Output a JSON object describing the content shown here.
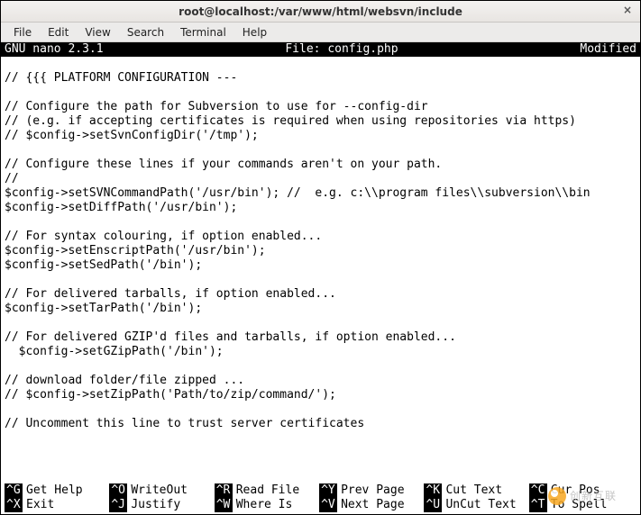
{
  "window": {
    "title": "root@localhost:/var/www/html/websvn/include",
    "close_glyph": "×"
  },
  "menubar": {
    "file": "File",
    "edit": "Edit",
    "view": "View",
    "search": "Search",
    "terminal": "Terminal",
    "help": "Help"
  },
  "nano": {
    "version": "GNU nano 2.3.1",
    "file_label": "File: config.php",
    "status": "Modified"
  },
  "content": "\n// {{{ PLATFORM CONFIGURATION ---\n\n// Configure the path for Subversion to use for --config-dir\n// (e.g. if accepting certificates is required when using repositories via https)\n// $config->setSvnConfigDir('/tmp');\n\n// Configure these lines if your commands aren't on your path.\n//\n$config->setSVNCommandPath('/usr/bin'); //  e.g. c:\\\\program files\\\\subversion\\\\bin\n$config->setDiffPath('/usr/bin');\n\n// For syntax colouring, if option enabled...\n$config->setEnscriptPath('/usr/bin');\n$config->setSedPath('/bin');\n\n// For delivered tarballs, if option enabled...\n$config->setTarPath('/bin');\n\n// For delivered GZIP'd files and tarballs, if option enabled...\n  $config->setGZipPath('/bin');\n\n// download folder/file zipped ...\n// $config->setZipPath('Path/to/zip/command/');\n\n// Uncomment this line to trust server certificates\n",
  "shortcuts": [
    {
      "key": "^G",
      "label": "Get Help"
    },
    {
      "key": "^O",
      "label": "WriteOut"
    },
    {
      "key": "^R",
      "label": "Read File"
    },
    {
      "key": "^Y",
      "label": "Prev Page"
    },
    {
      "key": "^K",
      "label": "Cut Text"
    },
    {
      "key": "^C",
      "label": "Cur Pos"
    },
    {
      "key": "^X",
      "label": "Exit"
    },
    {
      "key": "^J",
      "label": "Justify"
    },
    {
      "key": "^W",
      "label": "Where Is"
    },
    {
      "key": "^V",
      "label": "Next Page"
    },
    {
      "key": "^U",
      "label": "UnCut Text"
    },
    {
      "key": "^T",
      "label": "To Spell"
    }
  ],
  "watermark": "创新互联"
}
